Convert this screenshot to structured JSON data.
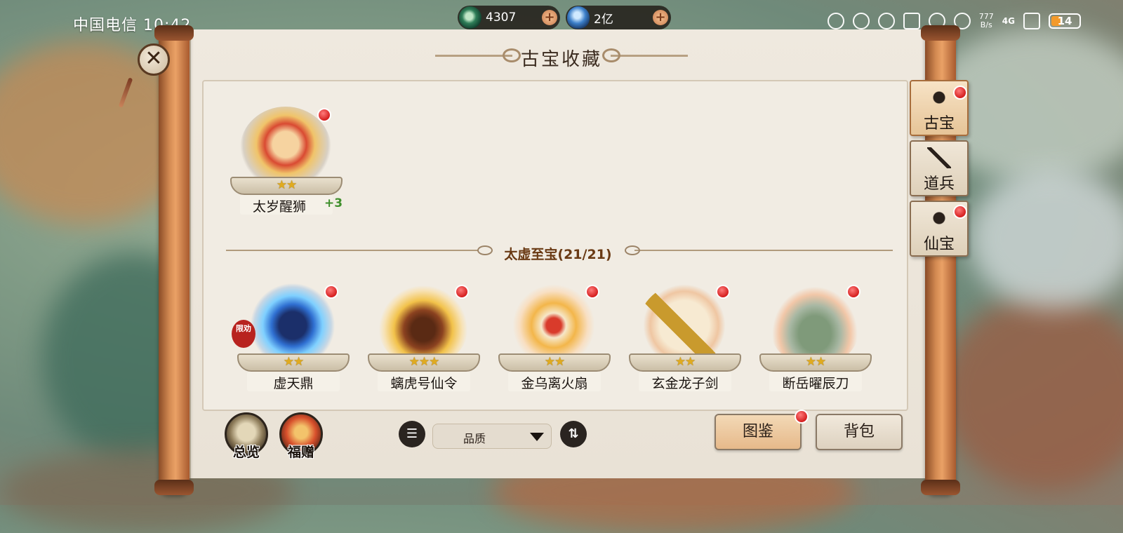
{
  "status_bar": {
    "carrier_time": "中国电信 10:42",
    "speed_value": "777",
    "speed_unit": "B/s",
    "network": "4G",
    "battery": "14"
  },
  "currency": [
    {
      "icon": "jade-coin-icon",
      "value": "4307"
    },
    {
      "icon": "blue-crystal-icon",
      "value": "2亿"
    }
  ],
  "page_title": "古宝收藏",
  "side_tabs": [
    {
      "label": "古宝",
      "icon": "lotus-icon",
      "active": true,
      "badge": true
    },
    {
      "label": "道兵",
      "icon": "sword-icon",
      "active": false,
      "badge": false
    },
    {
      "label": "仙宝",
      "icon": "spiral-icon",
      "active": false,
      "badge": true
    }
  ],
  "featured_item": {
    "name": "太岁醒狮",
    "stars": "★★",
    "bonus": "+3",
    "badge": true
  },
  "section": {
    "title": "太虚至宝(21/21)"
  },
  "items": [
    {
      "name": "虚天鼎",
      "stars": "★★",
      "badge_text": "限劝",
      "badge": true
    },
    {
      "name": "螭虎号仙令",
      "stars": "★★★",
      "badge": true
    },
    {
      "name": "金乌离火扇",
      "stars": "★★",
      "badge": true
    },
    {
      "name": "玄金龙子剑",
      "stars": "★★",
      "badge": true
    },
    {
      "name": "断岳曜辰刀",
      "stars": "★★",
      "badge": true
    }
  ],
  "bottom": {
    "overview_label": "总览",
    "gift_label": "福赠",
    "sort_label": "品质",
    "atlas_label": "图鉴",
    "bag_label": "背包"
  },
  "colors": {
    "badge_red": "#d51f1f",
    "star_gold": "#e0ab1f",
    "scroll_wood": "#d38a52",
    "paper": "#efe9df"
  }
}
